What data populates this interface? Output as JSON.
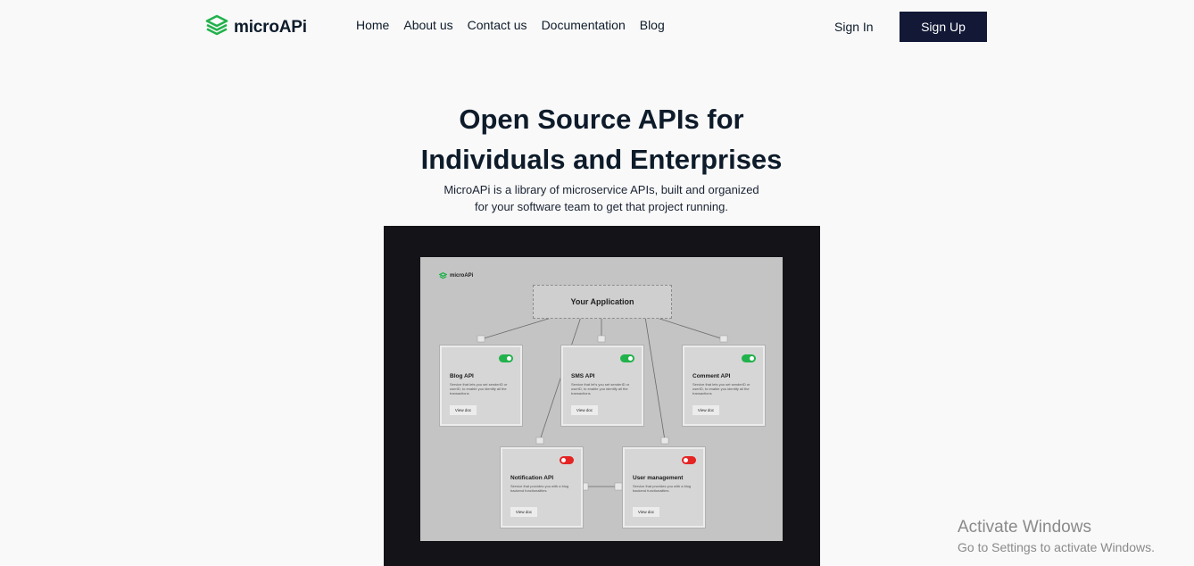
{
  "brand": {
    "name": "microAPi",
    "icon": "layers-icon",
    "color": "#22b24c"
  },
  "nav": {
    "links": [
      "Home",
      "About us",
      "Contact us",
      "Documentation",
      "Blog"
    ],
    "sign_in": "Sign In",
    "sign_up": "Sign Up"
  },
  "hero": {
    "title_line1": "Open Source APIs for",
    "title_line2": "Individuals and Enterprises",
    "subtitle_line1": "MicroAPi is a library of microservice APIs, built and organized",
    "subtitle_line2": "for your software team to get that project running."
  },
  "illustration": {
    "logo_text": "microAPi",
    "app_label": "Your Application",
    "cards": [
      {
        "title": "Blog API",
        "desc": "Service that lets you set senderID or userID, to enable you identify all the transactions",
        "button": "View doc",
        "enabled": true
      },
      {
        "title": "SMS API",
        "desc": "Service that let's you set senderID or userID, to enable you identify all the transactions",
        "button": "View doc",
        "enabled": true
      },
      {
        "title": "Comment API",
        "desc": "Service that lets you set senderID or userID, to enable you identify all the transactions",
        "button": "View doc",
        "enabled": true
      },
      {
        "title": "Notification API",
        "desc": "Service that provides you with a blog backend functionalities",
        "button": "View doc",
        "enabled": false
      },
      {
        "title": "User management",
        "desc": "Service that provides you with a blog backend functionalities",
        "button": "View doc",
        "enabled": false
      }
    ],
    "colors": {
      "on": "#22b24c",
      "off": "#e52424",
      "frame": "#141418",
      "board": "#c4c4c4"
    }
  },
  "watermark": {
    "title": "Activate Windows",
    "subtitle": "Go to Settings to activate Windows."
  }
}
